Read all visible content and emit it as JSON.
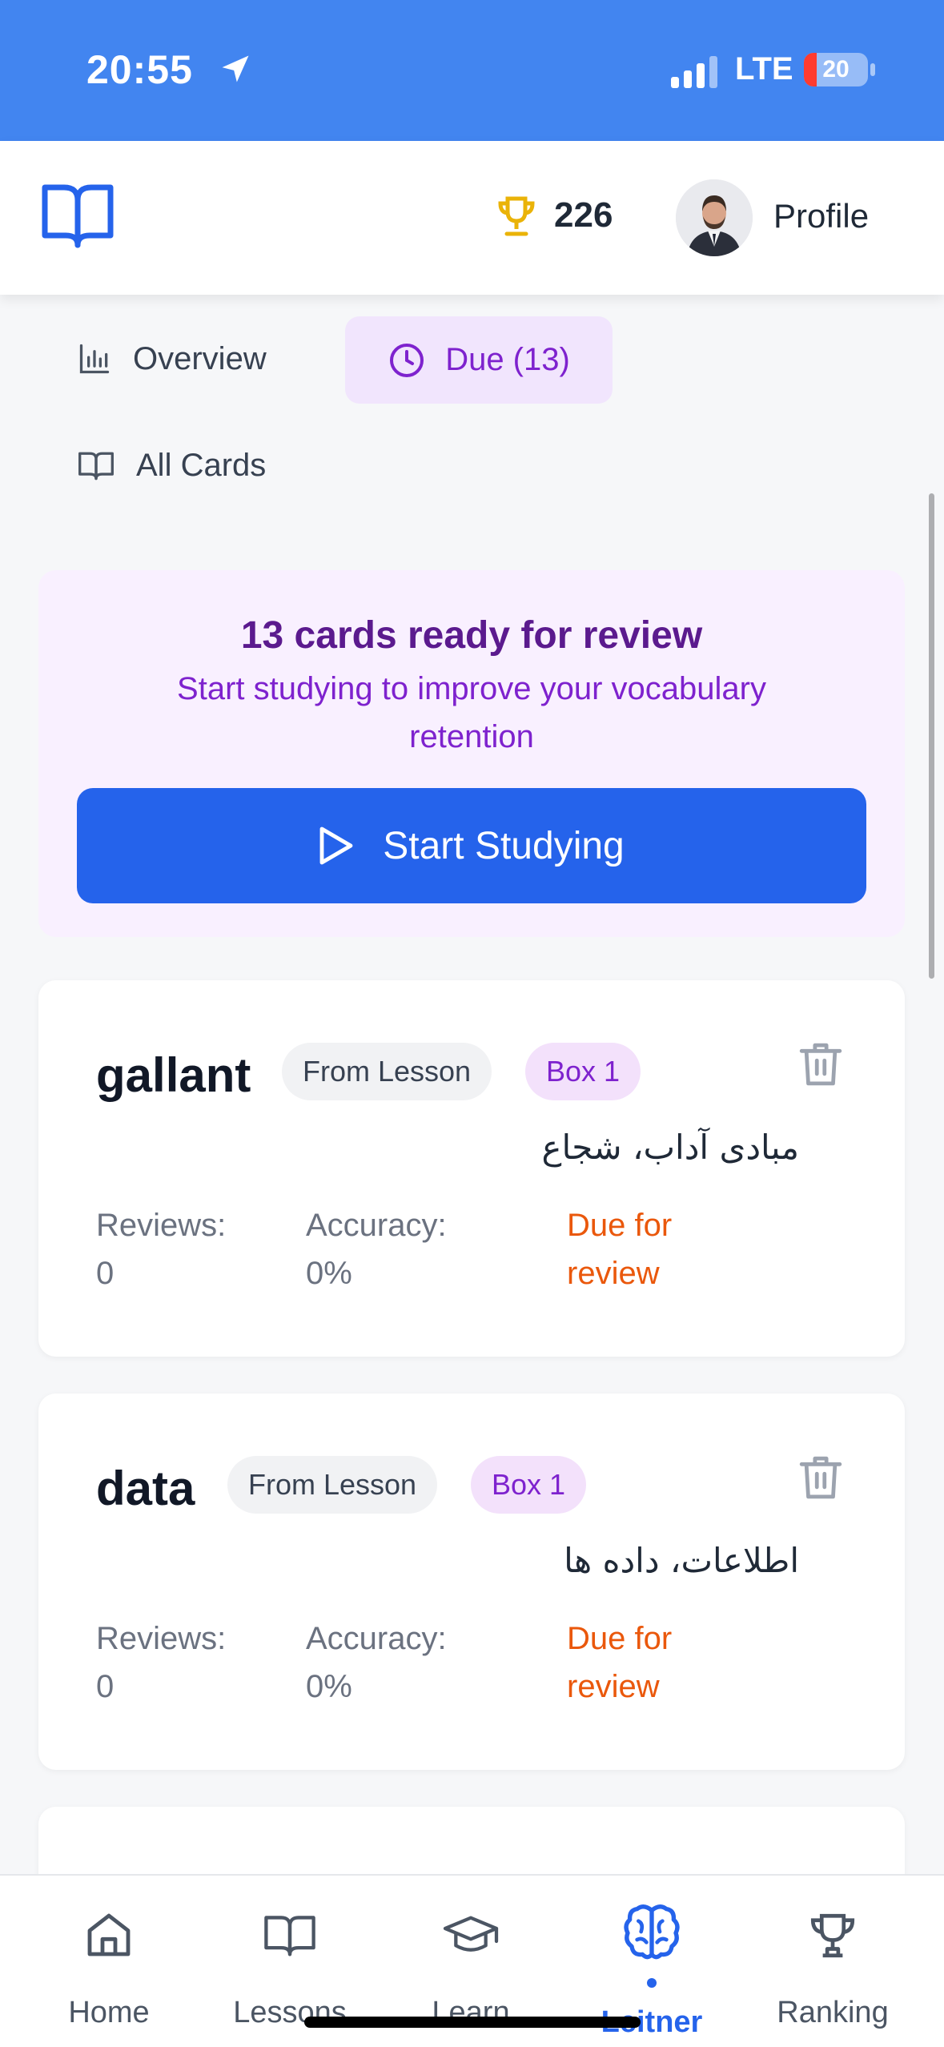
{
  "status_bar": {
    "time": "20:55",
    "network": "LTE",
    "battery": "20",
    "battery_level": 0.2
  },
  "header": {
    "score": "226",
    "profile_label": "Profile"
  },
  "tabs": [
    {
      "label": "Overview",
      "icon": "bar-chart-icon"
    },
    {
      "label": "Due (13)",
      "icon": "clock-icon",
      "active": true
    },
    {
      "label": "All Cards",
      "icon": "book-icon"
    }
  ],
  "banner": {
    "title": "13 cards ready for review",
    "subtitle": "Start studying to improve your vocabulary retention",
    "button": "Start Studying"
  },
  "cards": [
    {
      "word": "gallant",
      "source": "From Lesson",
      "box": "Box 1",
      "translation": "مبادی آداب، شجاع",
      "reviews_label": "Reviews:",
      "reviews": "0",
      "accuracy_label": "Accuracy:",
      "accuracy": "0%",
      "due_line1": "Due for",
      "due_line2": "review"
    },
    {
      "word": "data",
      "source": "From Lesson",
      "box": "Box 1",
      "translation": "اطلاعات، داده ها",
      "reviews_label": "Reviews:",
      "reviews": "0",
      "accuracy_label": "Accuracy:",
      "accuracy": "0%",
      "due_line1": "Due for",
      "due_line2": "review"
    }
  ],
  "bottom_nav": [
    {
      "label": "Home",
      "icon": "home-icon"
    },
    {
      "label": "Lessons",
      "icon": "book-icon"
    },
    {
      "label": "Learn",
      "icon": "graduation-cap-icon"
    },
    {
      "label": "Leitner",
      "icon": "brain-icon",
      "active": true
    },
    {
      "label": "Ranking",
      "icon": "trophy-icon"
    }
  ],
  "colors": {
    "status_bar": "#4285f0",
    "primary": "#2563eb",
    "accent_purple": "#7e22ce",
    "due_orange": "#ea580c",
    "trophy_gold": "#eab308"
  }
}
